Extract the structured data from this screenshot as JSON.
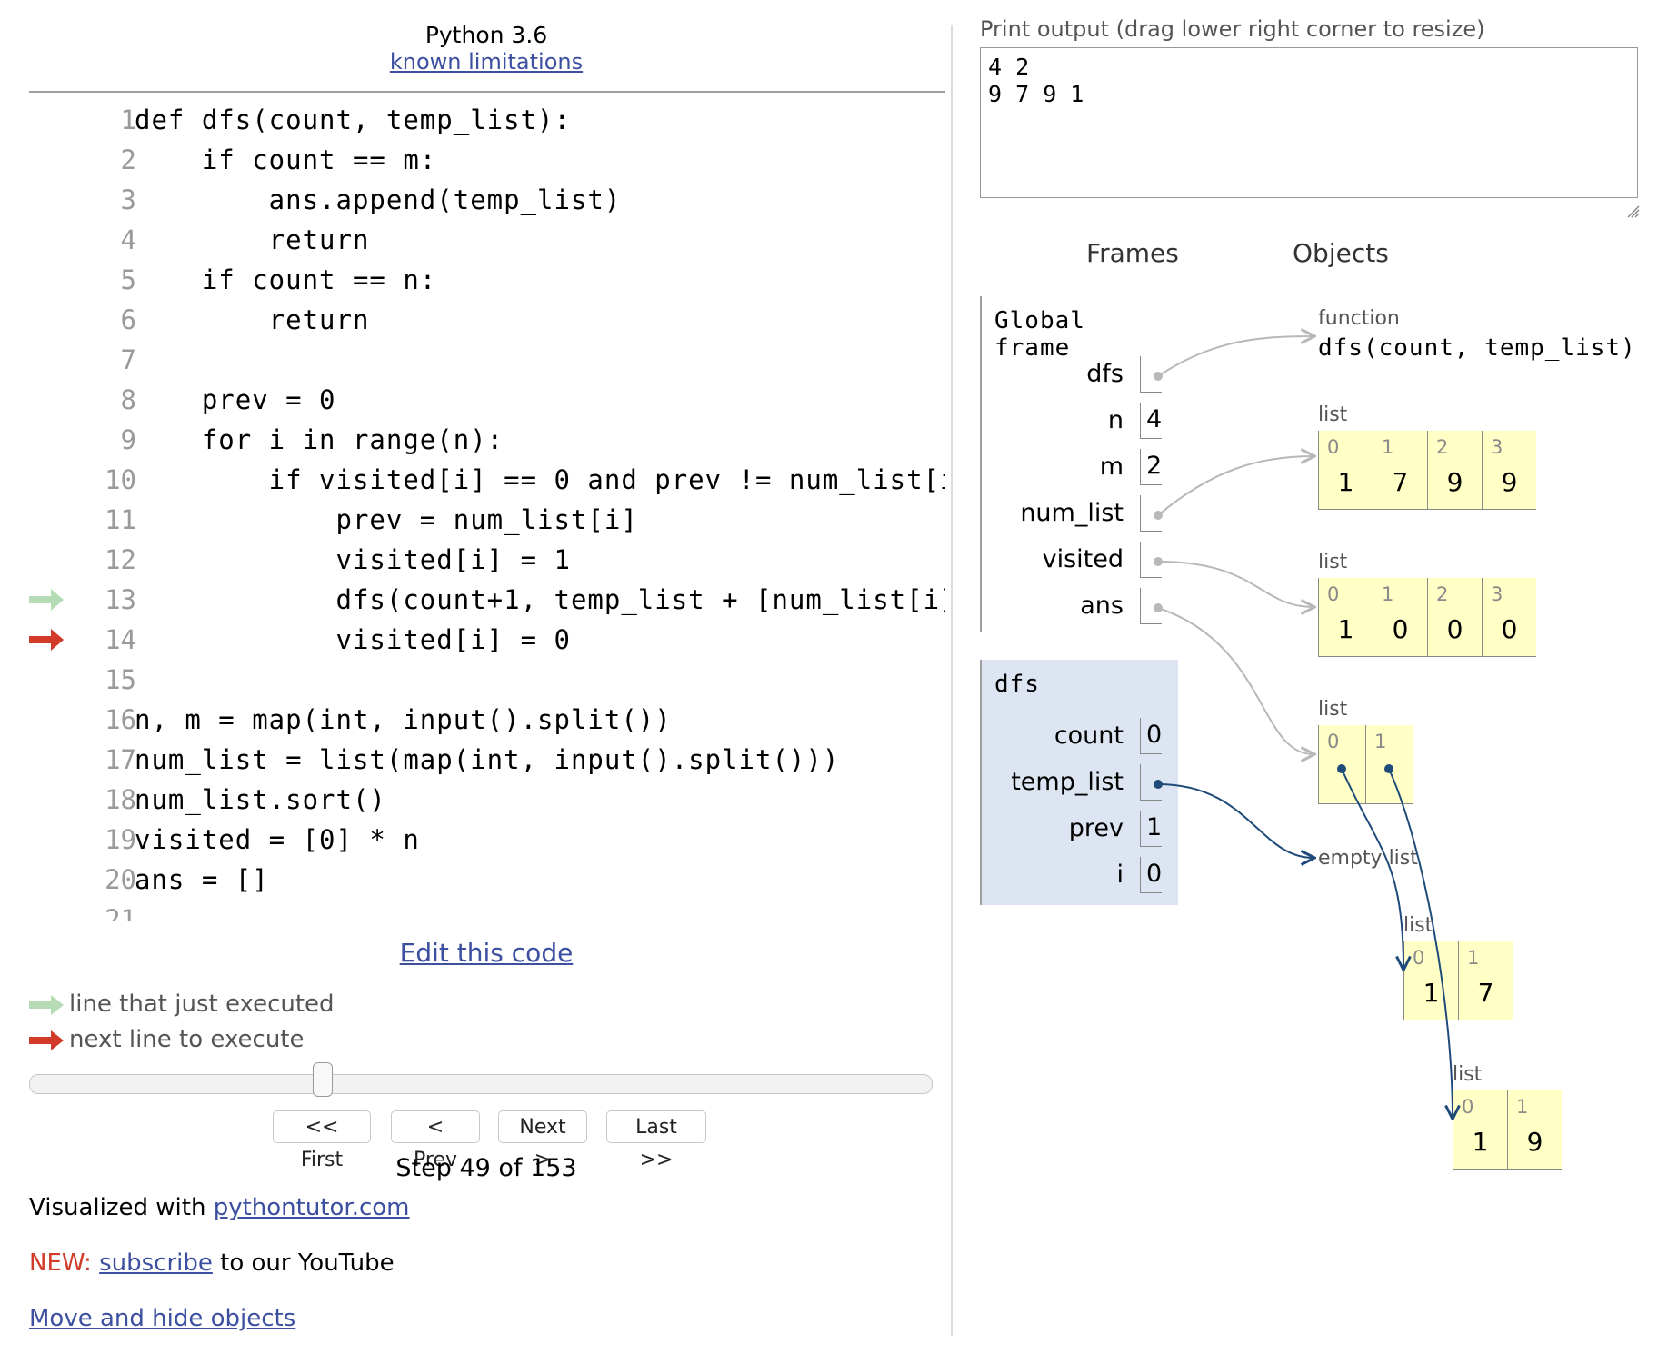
{
  "header": {
    "language": "Python 3.6",
    "limitations_link": "known limitations"
  },
  "code": {
    "lines": [
      {
        "no": "1",
        "text": "def dfs(count, temp_list):"
      },
      {
        "no": "2",
        "text": "    if count == m:"
      },
      {
        "no": "3",
        "text": "        ans.append(temp_list)"
      },
      {
        "no": "4",
        "text": "        return"
      },
      {
        "no": "5",
        "text": "    if count == n:"
      },
      {
        "no": "6",
        "text": "        return"
      },
      {
        "no": "7",
        "text": ""
      },
      {
        "no": "8",
        "text": "    prev = 0"
      },
      {
        "no": "9",
        "text": "    for i in range(n):"
      },
      {
        "no": "10",
        "text": "        if visited[i] == 0 and prev != num_list[i"
      },
      {
        "no": "11",
        "text": "            prev = num_list[i]"
      },
      {
        "no": "12",
        "text": "            visited[i] = 1"
      },
      {
        "no": "13",
        "text": "            dfs(count+1, temp_list + [num_list[i]"
      },
      {
        "no": "14",
        "text": "            visited[i] = 0"
      },
      {
        "no": "15",
        "text": ""
      },
      {
        "no": "16",
        "text": "n, m = map(int, input().split())"
      },
      {
        "no": "17",
        "text": "num_list = list(map(int, input().split()))"
      },
      {
        "no": "18",
        "text": "num_list.sort()"
      },
      {
        "no": "19",
        "text": "visited = [0] * n"
      },
      {
        "no": "20",
        "text": "ans = []"
      },
      {
        "no": "21",
        "text": ""
      }
    ],
    "just_executed_line": 13,
    "next_line": 14
  },
  "controls": {
    "edit_link": "Edit this code",
    "legend_just_executed": "line that just executed",
    "legend_next": "next line to execute",
    "slider_fraction": 0.32,
    "first": "<< First",
    "prev": "< Prev",
    "next": "Next >",
    "last": "Last >>",
    "step_text": "Step 49 of 153"
  },
  "footer": {
    "visualized_prefix": "Visualized with ",
    "visualized_link": "pythontutor.com",
    "new_tag": "NEW:",
    "subscribe_link": "subscribe",
    "subscribe_suffix": " to our YouTube",
    "move_hide_link": "Move and hide objects"
  },
  "output": {
    "label": "Print output (drag lower right corner to resize)",
    "text": "4 2\n9 7 9 1"
  },
  "viz": {
    "frames_heading": "Frames",
    "objects_heading": "Objects",
    "global_frame": {
      "title": "Global frame",
      "vars": [
        {
          "name": "dfs",
          "value": ""
        },
        {
          "name": "n",
          "value": "4"
        },
        {
          "name": "m",
          "value": "2"
        },
        {
          "name": "num_list",
          "value": ""
        },
        {
          "name": "visited",
          "value": ""
        },
        {
          "name": "ans",
          "value": ""
        }
      ]
    },
    "dfs_frame": {
      "title": "dfs",
      "vars": [
        {
          "name": "count",
          "value": "0"
        },
        {
          "name": "temp_list",
          "value": ""
        },
        {
          "name": "prev",
          "value": "1"
        },
        {
          "name": "i",
          "value": "0"
        }
      ]
    },
    "objects": {
      "function_label": "function",
      "function_sig": "dfs(count, temp_list)",
      "list_label": "list",
      "empty_list_label": "empty list",
      "num_list": {
        "indices": [
          "0",
          "1",
          "2",
          "3"
        ],
        "values": [
          "1",
          "7",
          "9",
          "9"
        ]
      },
      "visited": {
        "indices": [
          "0",
          "1",
          "2",
          "3"
        ],
        "values": [
          "1",
          "0",
          "0",
          "0"
        ]
      },
      "ans": {
        "indices": [
          "0",
          "1"
        ],
        "values": [
          "",
          ""
        ]
      },
      "list_a": {
        "indices": [
          "0",
          "1"
        ],
        "values": [
          "1",
          "7"
        ]
      },
      "list_b": {
        "indices": [
          "0",
          "1"
        ],
        "values": [
          "1",
          "9"
        ]
      }
    },
    "colors": {
      "global_pointer": "#b8b8b8",
      "frame_pointer": "#1f4b7a",
      "arrow_green": "#b6dcb6",
      "arrow_red": "#d23a2a",
      "list_bg": "#ffffc6",
      "frame_bg": "#dde5f2"
    }
  }
}
